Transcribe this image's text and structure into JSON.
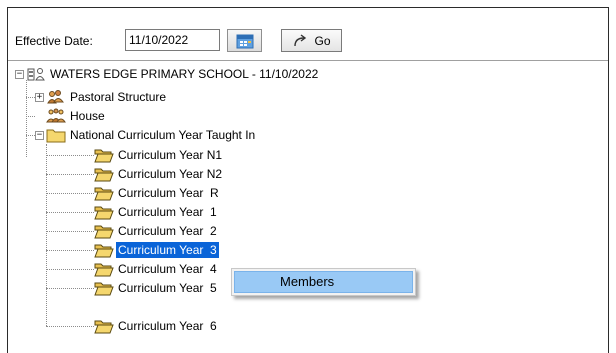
{
  "toolbar": {
    "effective_date_label": "Effective Date:",
    "effective_date_value": "11/10/2022",
    "go_label": "Go"
  },
  "tree": {
    "root": {
      "label": "WATERS EDGE PRIMARY SCHOOL - 11/10/2022",
      "icon": "school-icon",
      "expanded": true
    },
    "children": [
      {
        "label": "Pastoral Structure",
        "icon": "pastoral-structure-icon",
        "expanded": false
      },
      {
        "label": "House",
        "icon": "house-icon"
      },
      {
        "label": "National Curriculum Year Taught In",
        "icon": "folder-icon",
        "expanded": true,
        "items": [
          {
            "label": "Curriculum Year N1"
          },
          {
            "label": "Curriculum Year N2"
          },
          {
            "label": "Curriculum Year  R"
          },
          {
            "label": "Curriculum Year  1"
          },
          {
            "label": "Curriculum Year  2"
          },
          {
            "label": "Curriculum Year  3",
            "selected": true
          },
          {
            "label": "Curriculum Year  4"
          },
          {
            "label": "Curriculum Year  5"
          },
          {
            "label": "Curriculum Year  6"
          }
        ]
      }
    ]
  },
  "context_menu": {
    "items": [
      {
        "label": "Members",
        "highlighted": true
      }
    ]
  },
  "colors": {
    "selection": "#0a64d8",
    "menu_highlight": "#99c9f5",
    "folder": "#f5d76e"
  }
}
